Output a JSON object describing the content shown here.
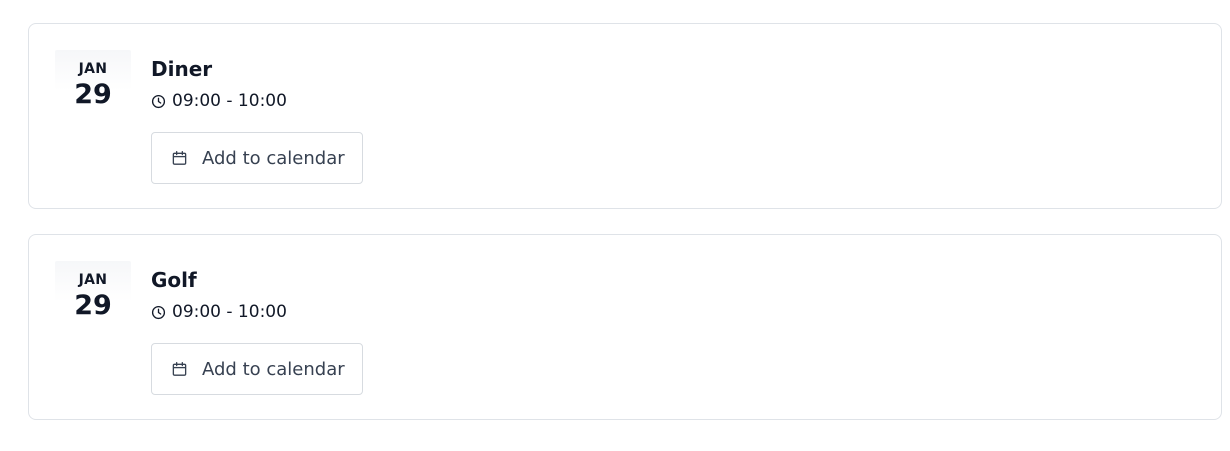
{
  "events": [
    {
      "month": "JAN",
      "day": "29",
      "title": "Diner",
      "time": "09:00 - 10:00",
      "add_label": "Add to calendar",
      "time_icon": "clock-icon",
      "add_icon": "calendar-icon"
    },
    {
      "month": "JAN",
      "day": "29",
      "title": "Golf",
      "time": "09:00 - 10:00",
      "add_label": "Add to calendar",
      "time_icon": "clock-icon",
      "add_icon": "calendar-icon"
    }
  ],
  "colors": {
    "text": "#111827",
    "muted_text": "#374151",
    "border": "#dfe3e8"
  }
}
